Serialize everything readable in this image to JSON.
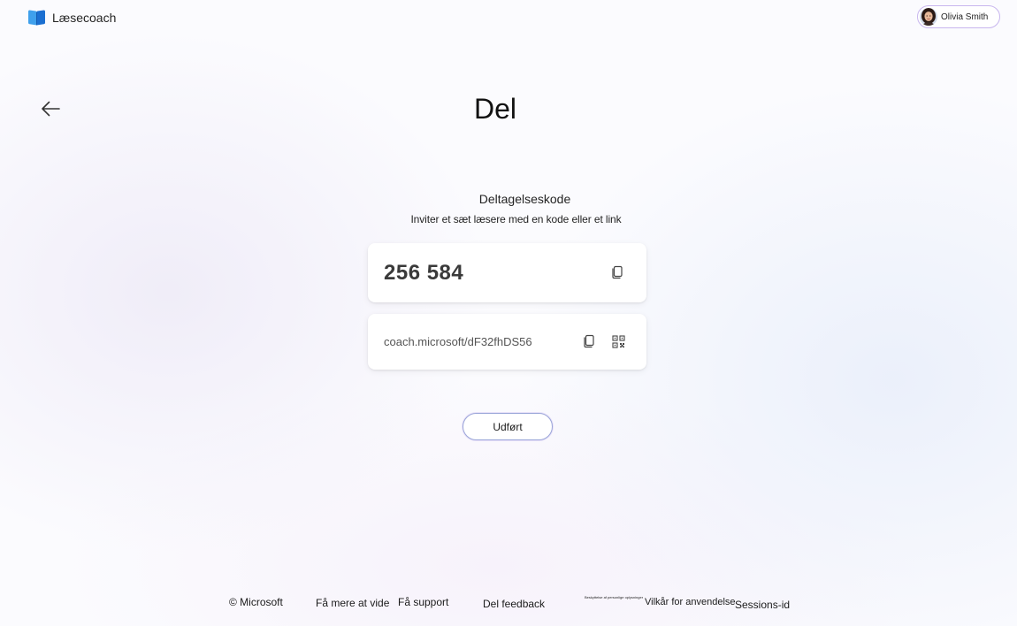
{
  "header": {
    "app_name": "Læsecoach",
    "user": {
      "name": "Olivia Smith"
    }
  },
  "page": {
    "title": "Del"
  },
  "join": {
    "section_title": "Deltagelseskode",
    "section_subtitle": "Inviter et sæt læsere med en kode eller et link",
    "code": "256 584",
    "link": "coach.microsoft/dF32fhDS56"
  },
  "actions": {
    "done_label": "Udført"
  },
  "footer": {
    "copyright": "© Microsoft",
    "learn_more": "Få mere at vide",
    "support": "Få support",
    "feedback": "Del feedback",
    "privacy": "Beskyttelse af personlige oplysninger",
    "terms": "Vilkår for anvendelse",
    "session_id": "Sessions-id"
  },
  "colors": {
    "accent_border": "#9aa6d8",
    "chip_border": "#c8b6ee",
    "brand_book_light": "#3fa0ec",
    "brand_book_dark": "#1b6fd1"
  },
  "icons": [
    "book-logo-icon",
    "avatar",
    "arrow-left-icon",
    "copy-icon",
    "qr-code-icon"
  ]
}
